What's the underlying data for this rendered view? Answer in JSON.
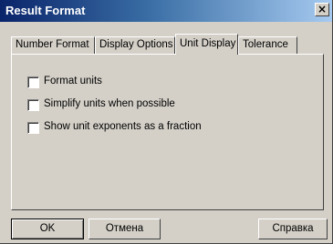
{
  "window": {
    "title": "Result Format",
    "close_glyph": "×"
  },
  "tabs": [
    {
      "label": "Number Format",
      "active": false
    },
    {
      "label": "Display Options",
      "active": false
    },
    {
      "label": "Unit Display",
      "active": true
    },
    {
      "label": "Tolerance",
      "active": false
    }
  ],
  "options": [
    {
      "label": "Format units",
      "checked": false
    },
    {
      "label": "Simplify units when possible",
      "checked": false
    },
    {
      "label": "Show unit exponents as a fraction",
      "checked": false
    }
  ],
  "buttons": {
    "ok": "OK",
    "cancel": "Отмена",
    "help": "Справка"
  },
  "icons": {
    "close": "close-icon"
  }
}
